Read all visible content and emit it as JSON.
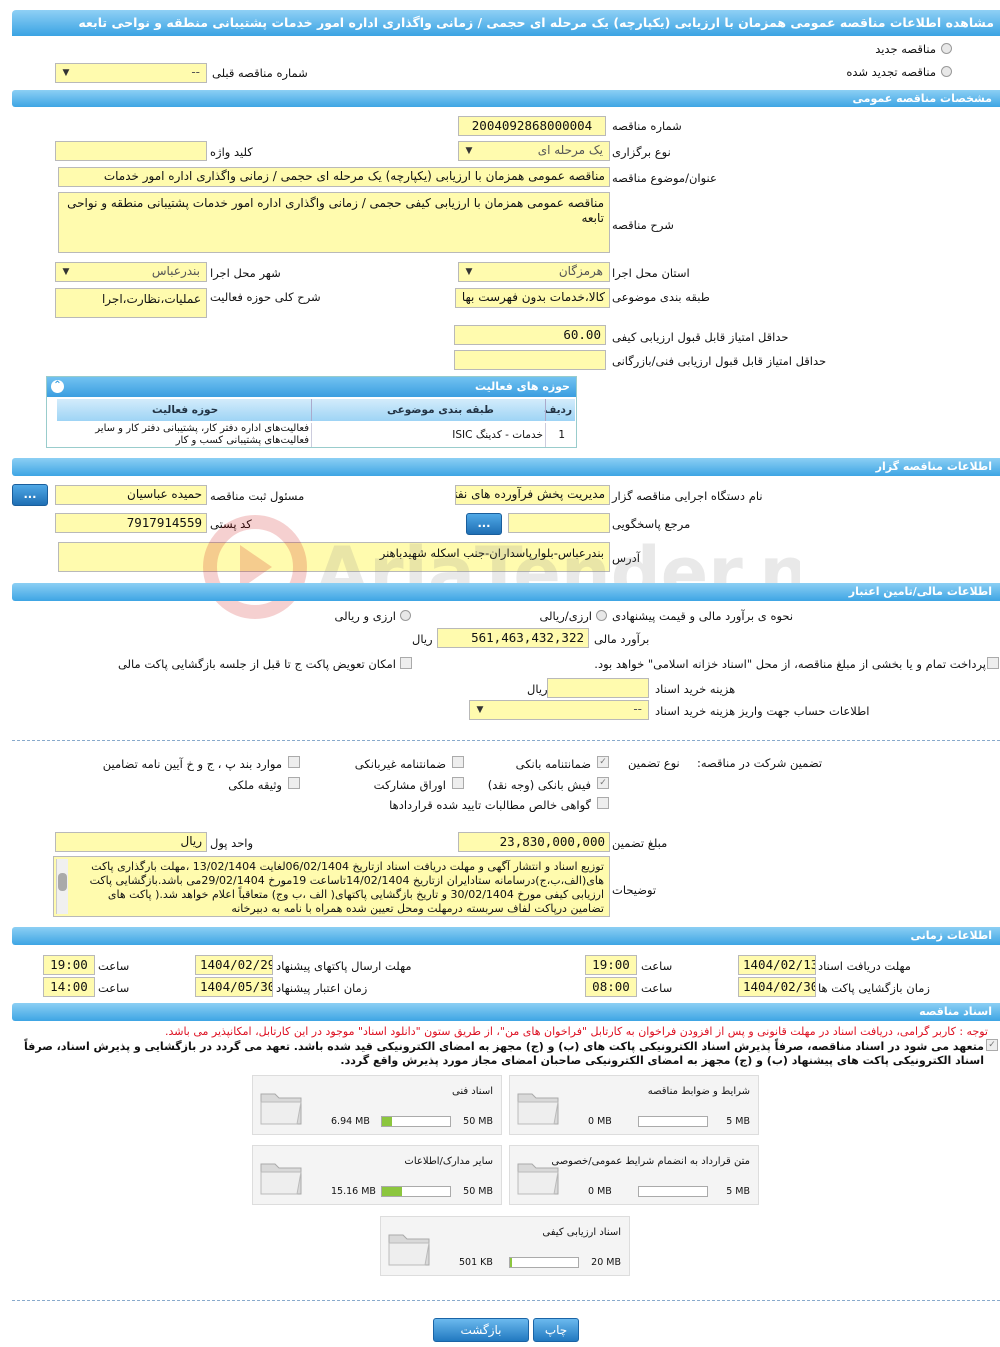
{
  "title": "مشاهده اطلاعات مناقصه عمومی همزمان با ارزیابی (یکپارچه) یک مرحله ای حجمی / زمانی واگذاری اداره امور خدمات پشتیبانی منطقه و نواحی تابعه",
  "top": {
    "new_label": "مناقصه جدید",
    "renewed_label": "مناقصه تجدید شده",
    "prev_label": "شماره مناقصه قبلی",
    "prev_value": "--"
  },
  "general": {
    "header": "مشخصات مناقصه عمومی",
    "number_label": "شماره مناقصه",
    "number": "2004092868000004",
    "type_label": "نوع برگزاری",
    "type": "یک مرحله ای",
    "keyword_label": "کلید واژه",
    "keyword": "",
    "subject_label": "عنوان/موضوع مناقصه",
    "subject": "مناقصه عمومی همزمان با ارزیابی (یکپارچه) یک مرحله ای حجمی / زمانی واگذاری اداره امور خدمات",
    "desc_label": "شرح مناقصه",
    "desc": "مناقصه عمومی همزمان با ارزیابی کیفی حجمی / زمانی واگذاری اداره امور خدمات پشتیبانی منطقه و نواحی تابعه",
    "province_label": "استان محل اجرا",
    "province": "هرمزگان",
    "city_label": "شهر محل اجرا",
    "city": "بندرعباس",
    "category_label": "طبقه بندی موضوعی",
    "category": "کالا،خدمات بدون فهرست بها",
    "scope_label": "شرح کلی حوزه فعالیت",
    "scope": "عملیات،نظارت،اجرا",
    "min_quality_label": "حداقل امتیاز قابل قبول ارزیابی کیفی",
    "min_quality": "60.00",
    "min_tech_label": "حداقل امتیاز قابل قبول ارزیابی فنی/بازرگانی",
    "min_tech": "",
    "activity": {
      "header": "حوزه های فعالیت",
      "col_row": "ردیف",
      "col_cat": "طبقه بندی موضوعی",
      "col_act": "حوزه فعالیت",
      "rows": [
        {
          "n": "1",
          "cat": "خدمات - کدینگ ISIC",
          "act": "فعالیت‌های اداره دفتر کار، پشتیبانی دفتر کار و سایر فعالیت‌های پشتیبانی کسب و کار"
        }
      ]
    }
  },
  "org": {
    "header": "اطلاعات مناقصه گزار",
    "name_label": "نام دستگاه اجرایی مناقصه گزار",
    "name": "مدیریت پخش فرآورده های نفتی",
    "resp_label": "مسئول ثبت مناقصه",
    "resp": "حمیده عباسیان",
    "ref_label": "مرجع پاسخگویی",
    "ref": "",
    "postal_label": "کد پستی",
    "postal": "7917914559",
    "addr_label": "آدرس",
    "addr": "بندرعباس-بلوارپاسداران-جنب اسکله شهیدباهنر",
    "dots": "..."
  },
  "finance": {
    "header": "اطلاعات مالی/تامین اعتبار",
    "method_label": "نحوه ی برآورد مالی و قیمت پیشنهادی",
    "opt1": "ارزی/ریالی",
    "opt2": "ارزی و ریالی",
    "estimate_label": "برآورد مالی",
    "estimate": "561,463,432,322",
    "rial": "ریال",
    "treasury_label": "پرداخت تمام و یا بخشی از مبلغ مناقصه، از محل \"اسناد خزانه اسلامی\" خواهد بود.",
    "swap_label": "امکان تعویض پاکت ج تا قبل از جلسه بازگشایی پاکت مالی",
    "doc_fee_label": "هزینه خرید اسناد",
    "doc_fee": "",
    "doc_fee_unit": "ریال",
    "account_label": "اطلاعات حساب جهت واریز هزینه خرید اسناد",
    "account": "--"
  },
  "guarantee": {
    "company_label": "تضمین شرکت در مناقصه:",
    "type_label": "نوع تضمین",
    "opts": [
      "ضمانتنامه بانکی",
      "ضمانتنامه غیربانکی",
      "موارد بند پ ، ج و خ آیین نامه تضامین",
      "فیش بانکی (وجه نقد)",
      "اوراق مشارکت",
      "وثیقه ملکی",
      "گواهی خالص مطالبات تایید شده قراردادها"
    ],
    "amount_label": "مبلغ تضمین",
    "amount": "23,830,000,000",
    "currency_label": "واحد پول",
    "currency": "ریال",
    "notes_label": "توضیحات",
    "notes": "توزیع اسناد و انتشار آگهی و مهلت دریافت اسناد ازتاریخ 06/02/1404لغایت 13/02/1404 ،مهلت بارگذاری پاکت های(الف،ب،ج)درسامانه ستادایران ازتاریخ 14/02/1404تاساعت 19مورخ 29/02/1404می باشد.بازگشایی پاکت ارزیابی کیفی مورخ 30/02/1404 و تاریخ بازگشایی پاکتهای( الف ،ب وج) متعاقباً اعلام خواهد شد.( پاکت های تضامین درپاکت لفاف سربسته درمهلت ومحل تعیین شده همراه با نامه به دبیرخانه"
  },
  "timing": {
    "header": "اطلاعات زمانی",
    "recv_label": "مهلت دریافت اسناد",
    "recv_date": "1404/02/13",
    "recv_time": "19:00",
    "send_label": "مهلت ارسال پاکتهای پیشنهاد",
    "send_date": "1404/02/29",
    "send_time": "19:00",
    "open_label": "زمان بازگشایی پاکت ها",
    "open_date": "1404/02/30",
    "open_time": "08:00",
    "valid_label": "زمان اعتبار پیشنهاد",
    "valid_date": "1404/05/30",
    "valid_time": "14:00",
    "time_label": "ساعت"
  },
  "docs": {
    "header": "اسناد مناقصه",
    "note": "توجه : کاربر گرامی، دریافت اسناد در مهلت قانونی و پس از افزودن فراخوان به کارتابل \"فراخوان های من\"، از طریق ستون \"دانلود اسناد\" موجود در این کارتابل، امکانپذیر می باشد.",
    "commit": "متعهد می شود در اسناد مناقصه، صرفاً پذیرش اسناد الکترونیکی پاکت های (ب) و (ج) مجهز به امضای الکترونیکی قید شده باشد. تعهد می گردد در بازگشایی و پذیرش اسناد، صرفاً اسناد الکترونیکی پاکت های پیشنهاد (ب) و (ج) مجهز به امضای الکترونیکی صاحبان امضای مجاز مورد پذیرش واقع گردد.",
    "files": [
      {
        "name": "شرایط و ضوابط مناقصه",
        "cur": "0 MB",
        "max": "5 MB",
        "pct": 0
      },
      {
        "name": "اسناد فنی",
        "cur": "6.94 MB",
        "max": "50 MB",
        "pct": 14
      },
      {
        "name": "متن قرارداد به انضمام شرایط عمومی/خصوصی",
        "cur": "0 MB",
        "max": "5 MB",
        "pct": 0
      },
      {
        "name": "سایر مدارک/اطلاعات",
        "cur": "15.16 MB",
        "max": "50 MB",
        "pct": 30
      },
      {
        "name": "اسناد ارزیابی کیفی",
        "cur": "501 KB",
        "max": "20 MB",
        "pct": 3
      }
    ]
  },
  "buttons": {
    "print": "چاپ",
    "back": "بازگشت"
  },
  "watermark": "AriaTender.neT"
}
